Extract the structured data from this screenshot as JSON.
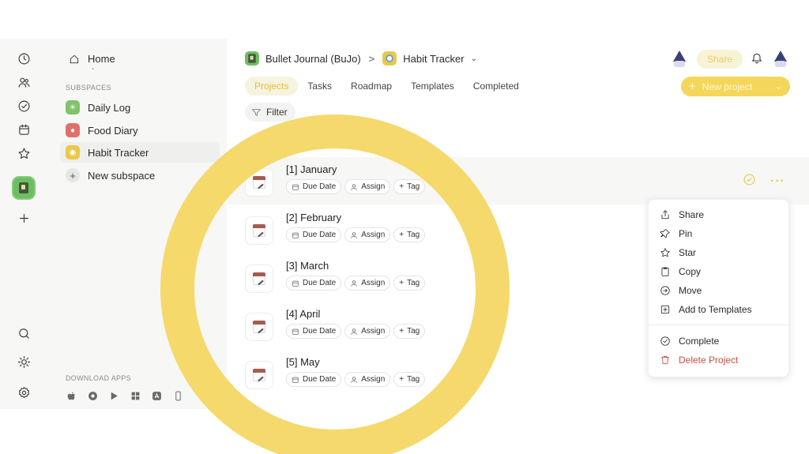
{
  "sidebar": {
    "home_label": "Home",
    "tick": "`",
    "section_label": "SUBSPACES",
    "items": [
      {
        "label": "Daily Log",
        "color": "#7fc46a",
        "icon": "sun-icon"
      },
      {
        "label": "Food Diary",
        "color": "#e0706a",
        "icon": "food-icon"
      },
      {
        "label": "Habit Tracker",
        "color": "#e8c94c",
        "icon": "tracker-icon"
      }
    ],
    "new_subspace_label": "New subspace",
    "download_label": "DOWNLOAD APPS",
    "apps": [
      "apple-icon",
      "chrome-icon",
      "play-store-icon",
      "windows-icon",
      "app-store-icon",
      "mobile-icon"
    ]
  },
  "rail": {
    "icons": [
      "clock-icon",
      "users-icon",
      "check-circle-icon",
      "calendar-icon",
      "star-icon",
      "space-icon",
      "plus-icon",
      "search-icon",
      "sun-icon",
      "gear-icon"
    ]
  },
  "header": {
    "breadcrumb": [
      {
        "label": "Bullet Journal (BuJo)",
        "color": "#6fbd63"
      },
      {
        "label": "Habit Tracker",
        "color": "#e8c94c"
      }
    ],
    "breadcrumb_separator": ">",
    "share_label": "Share",
    "new_project_label": "New project"
  },
  "tabs": [
    "Projects",
    "Tasks",
    "Roadmap",
    "Templates",
    "Completed"
  ],
  "active_tab": "Projects",
  "filter_label": "Filter",
  "chip_labels": {
    "due": "Due Date",
    "assign": "Assign",
    "tag": "Tag"
  },
  "projects": [
    {
      "title": "[1] January"
    },
    {
      "title": "[2] February"
    },
    {
      "title": "[3] March"
    },
    {
      "title": "[4] April"
    },
    {
      "title": "[5] May"
    }
  ],
  "context_menu": {
    "items": [
      "Share",
      "Pin",
      "Star",
      "Copy",
      "Move",
      "Add to Templates"
    ],
    "complete_label": "Complete",
    "delete_label": "Delete Project"
  },
  "colors": {
    "accent": "#f4d55c",
    "danger": "#c94f3f"
  }
}
